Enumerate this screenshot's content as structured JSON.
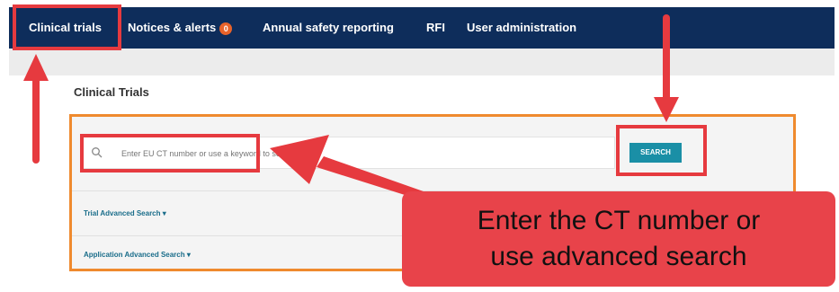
{
  "nav": {
    "items": [
      {
        "label": "Clinical trials"
      },
      {
        "label": "Notices & alerts",
        "badge": "0"
      },
      {
        "label": "Annual safety reporting"
      },
      {
        "label": "RFI"
      },
      {
        "label": "User administration"
      }
    ]
  },
  "page": {
    "title": "Clinical Trials"
  },
  "search": {
    "placeholder": "Enter EU CT number or use a keyword to search",
    "button_label": "SEARCH"
  },
  "advanced": {
    "trial_label": "Trial Advanced Search ▾",
    "application_label": "Application Advanced Search ▾"
  },
  "annotation": {
    "callout_line1": "Enter the CT number or",
    "callout_line2": "use advanced search"
  },
  "colors": {
    "nav_bg": "#0e2d5b",
    "accent_orange": "#ef8a2e",
    "highlight_red": "#e63a3f",
    "button_teal": "#1a8fa6"
  }
}
